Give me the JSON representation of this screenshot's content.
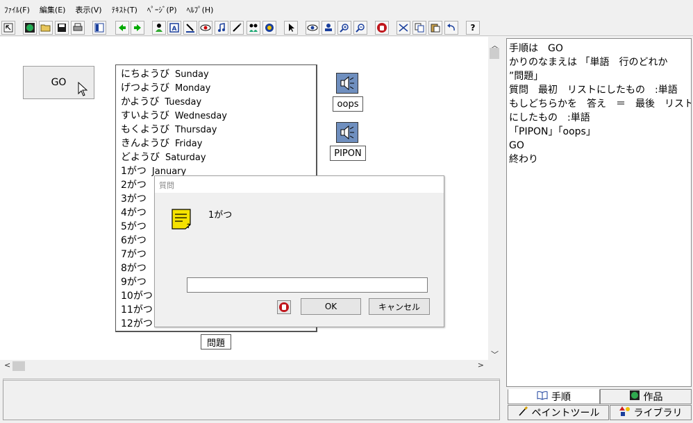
{
  "menu": [
    "ﾌｧｲﾙ(F)",
    "編集(E)",
    "表示(V)",
    "ﾃｷｽﾄ(T)",
    "ﾍﾟｰｼﾞ(P)",
    "ﾍﾙﾌﾟ(H)"
  ],
  "toolbar": {
    "icons": [
      "pointer-icon",
      "globe-icon",
      "open-folder-icon",
      "save-icon",
      "print-icon",
      "page-layout-icon",
      "back-arrow-icon",
      "forward-arrow-icon",
      "character-icon",
      "text-icon",
      "paint-icon",
      "eye-red-icon",
      "music-note-icon",
      "pen-icon",
      "animation-icon",
      "sound-icon",
      "select-arrow-icon",
      "eye-icon",
      "stamp-icon",
      "zoom-in-icon",
      "zoom-out-icon",
      "stop-hand-icon",
      "cut-icon",
      "copy-icon",
      "paste-icon",
      "undo-icon",
      "help-icon"
    ],
    "help_label": "?"
  },
  "stage": {
    "go_button": "GO",
    "list_items": [
      {
        "jp": "にちようび",
        "en": "Sunday"
      },
      {
        "jp": "げつようび",
        "en": "Monday"
      },
      {
        "jp": "かようび",
        "en": "Tuesday"
      },
      {
        "jp": "すいようび",
        "en": "Wednesday"
      },
      {
        "jp": "もくようび",
        "en": "Thursday"
      },
      {
        "jp": "きんようび",
        "en": "Friday"
      },
      {
        "jp": "どようび",
        "en": "Saturday"
      },
      {
        "jp": "1がつ",
        "en": "January"
      },
      {
        "jp": "2がつ",
        "en": ""
      },
      {
        "jp": "3がつ",
        "en": ""
      },
      {
        "jp": "4がつ",
        "en": ""
      },
      {
        "jp": "5がつ",
        "en": ""
      },
      {
        "jp": "6がつ",
        "en": ""
      },
      {
        "jp": "7がつ",
        "en": ""
      },
      {
        "jp": "8がつ",
        "en": ""
      },
      {
        "jp": "9がつ",
        "en": ""
      },
      {
        "jp": "10がつ",
        "en": ""
      },
      {
        "jp": "11がつ",
        "en": ""
      },
      {
        "jp": "12がつ",
        "en": ""
      }
    ],
    "sound1_label": "oops",
    "sound2_label": "PIPON",
    "mondai_label": "問題"
  },
  "dialog": {
    "title": "質問",
    "message": "1がつ",
    "input_value": "",
    "ok_label": "OK",
    "cancel_label": "キャンセル"
  },
  "script": {
    "lines": [
      "手順は　GO",
      "かりのなまえは 「単語　行のどれか",
      "”問題」",
      "質問　最初　リストにしたもの　:単語",
      "もしどちらかを　答え　＝　最後　リスト",
      "にしたもの　:単語",
      "「PIPON」「oops」",
      "GO",
      "終わり"
    ]
  },
  "tabs": {
    "procedure": "手順",
    "works": "作品",
    "paint_tool": "ペイントツール",
    "library": "ライブラリ"
  },
  "colors": {
    "sound_button": "#6f8fbf",
    "memo_icon": "#f5e200",
    "stop_icon": "#c0161c"
  }
}
